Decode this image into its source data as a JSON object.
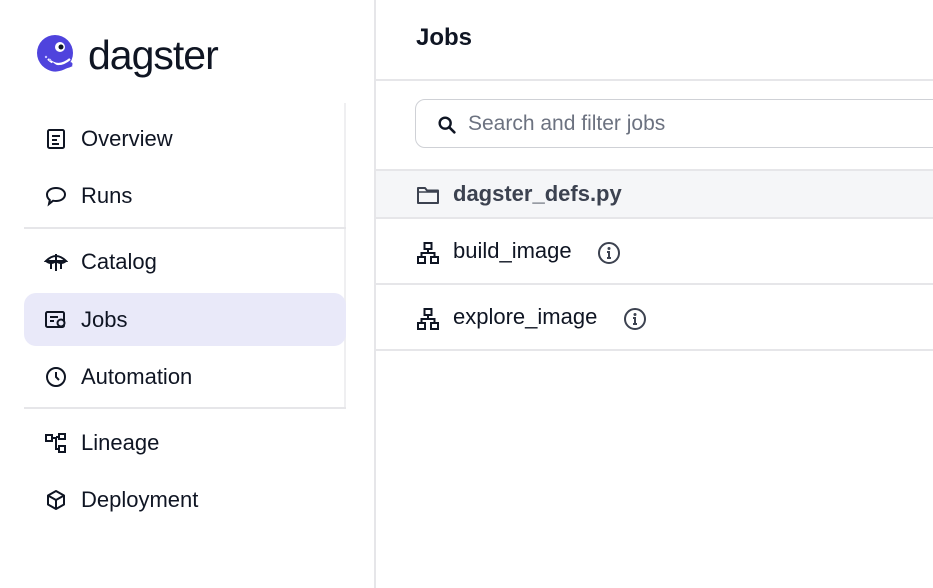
{
  "app": {
    "brand": "dagster",
    "accent": "#4f43dd"
  },
  "sidebar": {
    "items": [
      {
        "label": "Overview",
        "icon": "overview-icon"
      },
      {
        "label": "Runs",
        "icon": "runs-icon"
      },
      {
        "label": "Catalog",
        "icon": "catalog-icon"
      },
      {
        "label": "Jobs",
        "icon": "jobs-icon",
        "active": true
      },
      {
        "label": "Automation",
        "icon": "clock-icon"
      },
      {
        "label": "Lineage",
        "icon": "lineage-icon"
      },
      {
        "label": "Deployment",
        "icon": "cube-icon"
      }
    ]
  },
  "main": {
    "title": "Jobs",
    "search": {
      "placeholder": "Search and filter jobs",
      "value": ""
    },
    "folder": {
      "label": "dagster_defs.py",
      "icon": "folder-icon"
    },
    "jobs": [
      {
        "label": "build_image",
        "icon": "job-graph-icon"
      },
      {
        "label": "explore_image",
        "icon": "job-graph-icon"
      }
    ]
  }
}
